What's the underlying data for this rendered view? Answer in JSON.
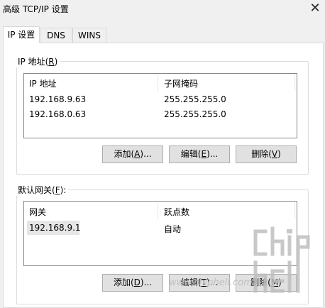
{
  "window": {
    "title": "高级 TCP/IP 设置",
    "close_glyph": "✕"
  },
  "tabs": [
    {
      "label": "IP 设置",
      "active": true
    },
    {
      "label": "DNS",
      "active": false
    },
    {
      "label": "WINS",
      "active": false
    }
  ],
  "ip_group": {
    "label_prefix": "IP 地址(",
    "label_key": "R",
    "label_suffix": ")",
    "columns": [
      "IP 地址",
      "子网掩码"
    ],
    "rows": [
      [
        "192.168.9.63",
        "255.255.255.0"
      ],
      [
        "192.168.0.63",
        "255.255.255.0"
      ]
    ],
    "buttons": {
      "add": {
        "prefix": "添加(",
        "key": "A",
        "suffix": ")..."
      },
      "edit": {
        "prefix": "编辑(",
        "key": "E",
        "suffix": ")..."
      },
      "delete": {
        "prefix": "删除(",
        "key": "V",
        "suffix": ")"
      }
    }
  },
  "gateway_group": {
    "label_prefix": "默认网关(",
    "label_key": "F",
    "label_suffix": "):",
    "columns": [
      "网关",
      "跃点数"
    ],
    "rows": [
      [
        "192.168.9.1",
        "自动"
      ]
    ],
    "buttons": {
      "add": {
        "prefix": "添加(",
        "key": "D",
        "suffix": ")..."
      },
      "edit": {
        "prefix": "编辑(",
        "key": "T",
        "suffix": ")..."
      },
      "delete": {
        "prefix": "删除(",
        "key": "M",
        "suffix": ")"
      }
    }
  },
  "watermark": {
    "text": "www.chiphell.com",
    "logo_text": "chip hell"
  }
}
